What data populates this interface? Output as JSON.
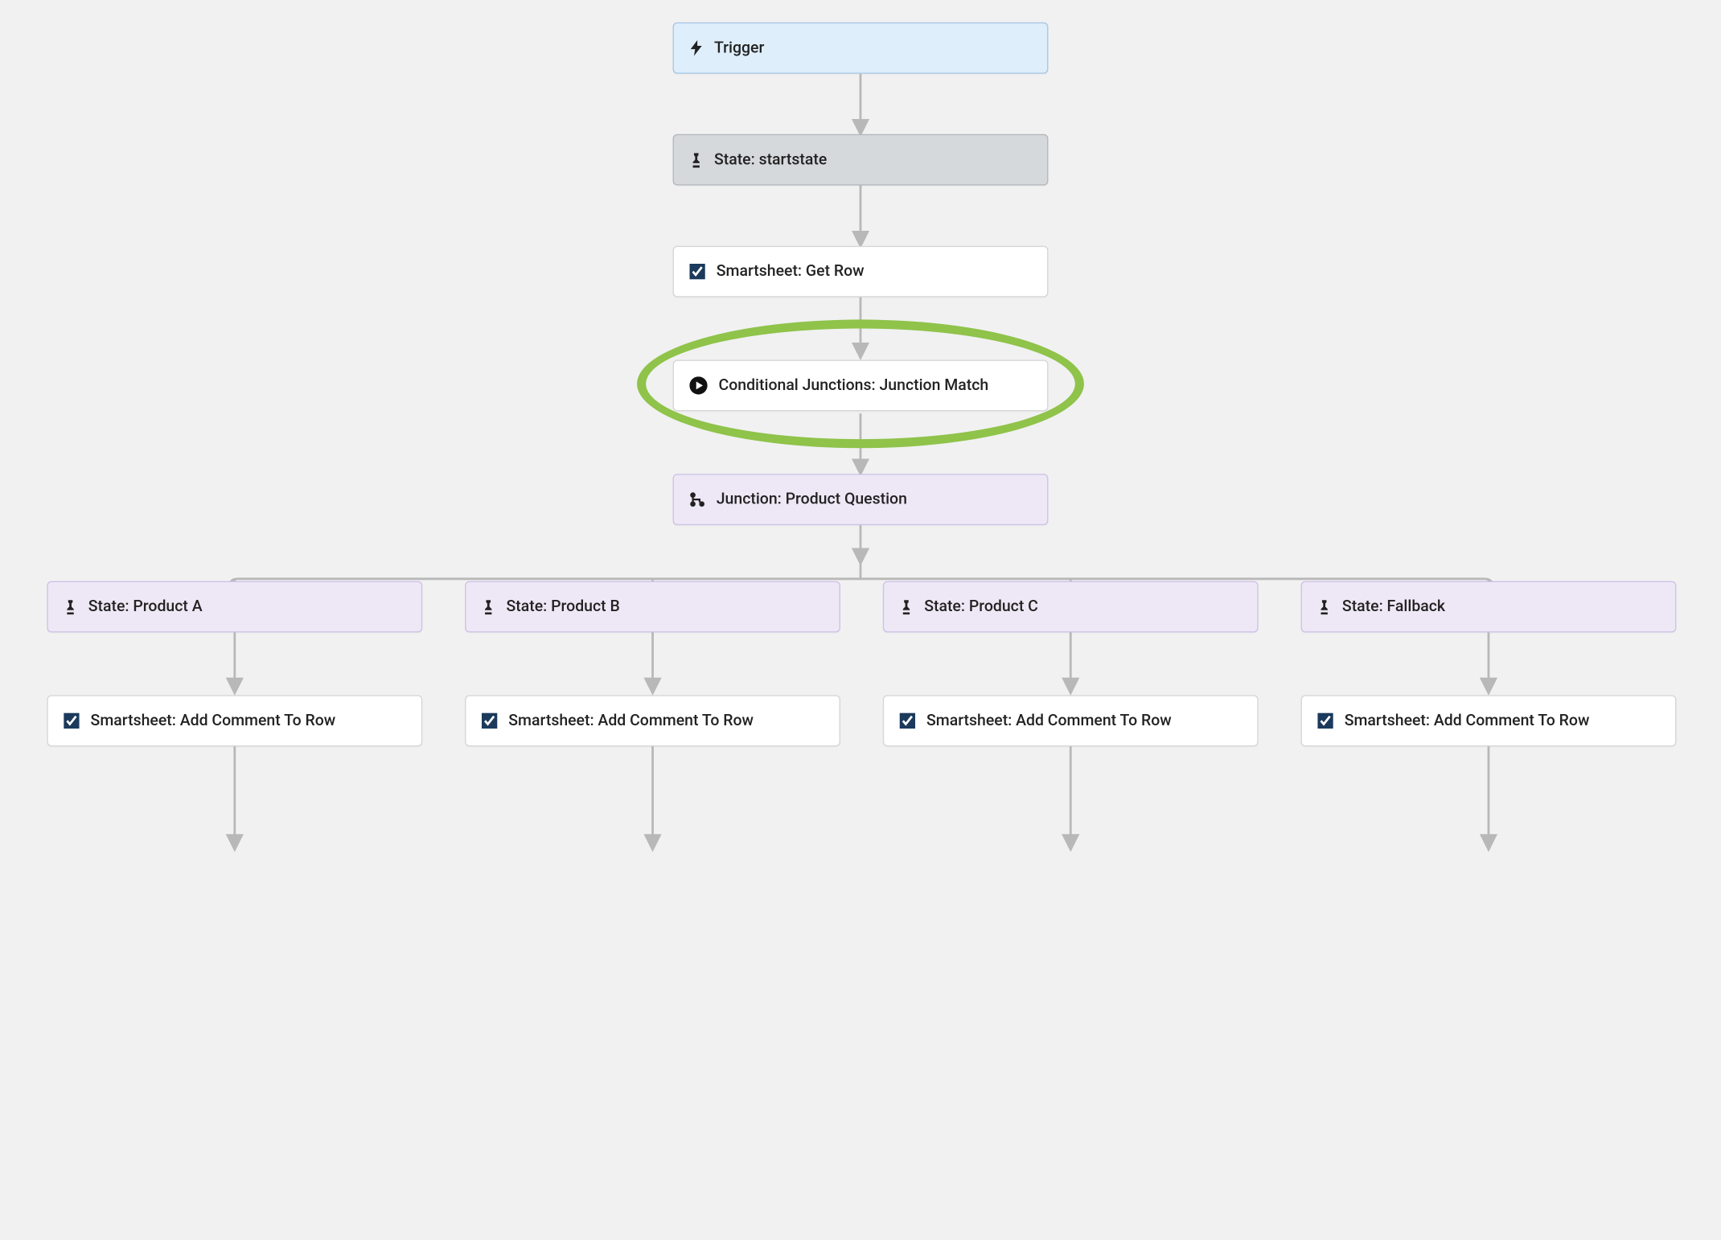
{
  "nodes": {
    "trigger": {
      "label": "Trigger"
    },
    "startstate": {
      "label": "State: startstate"
    },
    "getrow": {
      "label": "Smartsheet: Get Row"
    },
    "cj": {
      "label": "Conditional Junctions: Junction Match"
    },
    "junction": {
      "label": "Junction: Product Question"
    },
    "stateA": {
      "label": "State: Product A"
    },
    "stateB": {
      "label": "State: Product B"
    },
    "stateC": {
      "label": "State: Product C"
    },
    "stateF": {
      "label": "State: Fallback"
    },
    "commentA": {
      "label": "Smartsheet: Add Comment To Row"
    },
    "commentB": {
      "label": "Smartsheet: Add Comment To Row"
    },
    "commentC": {
      "label": "Smartsheet: Add Comment To Row"
    },
    "commentF": {
      "label": "Smartsheet: Add Comment To Row"
    }
  },
  "colors": {
    "trigger_bg": "#dfeefb",
    "trigger_bd": "#a9c7e3",
    "state_bg": "#d6d9dc",
    "state_bd": "#b4b8bc",
    "white_bg": "#ffffff",
    "white_bd": "#d6d6d6",
    "lavender_bg": "#eee8f6",
    "lavender_bd": "#cfc2e6",
    "highlight": "#8fc34a",
    "connector": "#b8b8b8"
  },
  "icons": {
    "bolt": "bolt-icon",
    "chess": "chess-piece-icon",
    "smartsheet": "smartsheet-check-icon",
    "play": "play-circle-icon",
    "junction": "branch-icon"
  },
  "highlighted_node": "cj"
}
